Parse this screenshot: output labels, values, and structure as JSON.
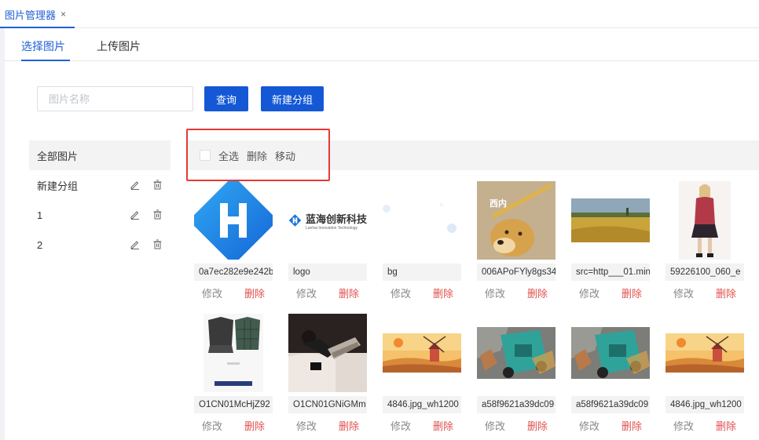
{
  "tab": {
    "title": "图片管理器",
    "close": "×"
  },
  "subtabs": [
    "选择图片",
    "上传图片"
  ],
  "search": {
    "placeholder": "图片名称",
    "value": ""
  },
  "buttons": {
    "query": "查询",
    "new_group": "新建分组"
  },
  "groups": [
    {
      "label": "全部图片",
      "active": true,
      "editable": false
    },
    {
      "label": "新建分组",
      "active": false,
      "editable": true
    },
    {
      "label": "1",
      "active": false,
      "editable": true
    },
    {
      "label": "2",
      "active": false,
      "editable": true
    }
  ],
  "toolbar": {
    "select_all": "全选",
    "delete": "删除",
    "move": "移动"
  },
  "colors": {
    "accent": "#1558d6",
    "danger": "#e0524f",
    "highlight_border": "#e53935"
  },
  "images": [
    {
      "name": "0a7ec282e9e242b",
      "thumb": "h-logo-icon"
    },
    {
      "name": "logo",
      "thumb": "lanhai-logo",
      "logo_text": "蓝海创新科技",
      "logo_sub": "Lanhai Innovation Technology"
    },
    {
      "name": "bg",
      "thumb": "light-background"
    },
    {
      "name": "006APoFYly8gs34",
      "thumb": "doge-meme",
      "meme_text": "西内"
    },
    {
      "name": "src=http___01.min",
      "thumb": "wheat-field"
    },
    {
      "name": "59226100_060_e",
      "thumb": "woman-red-sweater"
    },
    {
      "name": "O1CN01McHjZ92",
      "thumb": "clothing-product"
    },
    {
      "name": "O1CN01GNiGMm",
      "thumb": "woman-sofa"
    },
    {
      "name": "4846.jpg_wh1200",
      "thumb": "windmill-illustration"
    },
    {
      "name": "a58f9621a39dc09",
      "thumb": "game-screenshot"
    },
    {
      "name": "a58f9621a39dc09",
      "thumb": "game-screenshot"
    },
    {
      "name": "4846.jpg_wh1200",
      "thumb": "windmill-illustration"
    }
  ],
  "card_actions": {
    "edit": "修改",
    "delete": "删除"
  }
}
